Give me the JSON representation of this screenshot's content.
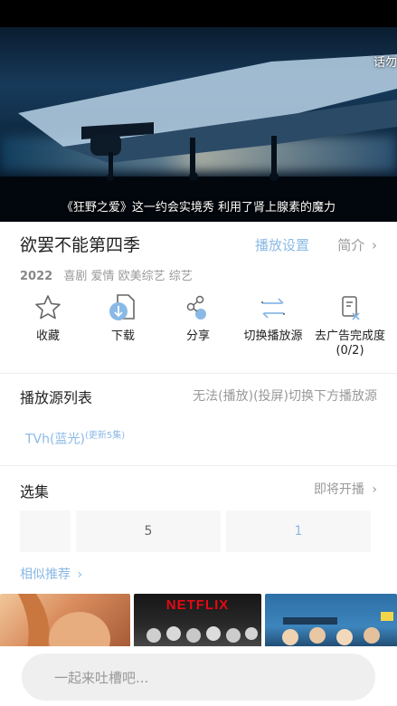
{
  "player": {
    "subtitle": "《狂野之爱》这一约会实境秀 利用了肾上腺素的魔力",
    "corner_text": "话勿"
  },
  "show": {
    "title": "欲罢不能第四季",
    "play_settings": "播放设置",
    "intro": "简介",
    "year": "2022",
    "tags": "喜剧 爱情 欧美综艺 综艺"
  },
  "actions": [
    {
      "label": "收藏",
      "icon": "star-icon"
    },
    {
      "label": "下载",
      "icon": "download-icon"
    },
    {
      "label": "分享",
      "icon": "share-icon"
    },
    {
      "label": "切换播放源",
      "icon": "switch-source-icon"
    },
    {
      "label": "去广告完成度\n(0/2)",
      "icon": "ad-removal-icon"
    }
  ],
  "sources": {
    "heading": "播放源列表",
    "note": "无法(播放)(投屏)切换下方播放源",
    "chip_label": "TVh(蓝光)",
    "chip_badge": "(更新5集)"
  },
  "episodes": {
    "heading": "选集",
    "status": "即将开播",
    "cells": [
      "",
      "5",
      "1"
    ]
  },
  "recommend": {
    "heading": "相似推荐",
    "brand_text": "NETFLIX"
  },
  "comment": {
    "placeholder": "一起来吐槽吧..."
  },
  "colors": {
    "accent": "#8ab9e6",
    "muted": "#999999",
    "netflix_red": "#e50914"
  }
}
